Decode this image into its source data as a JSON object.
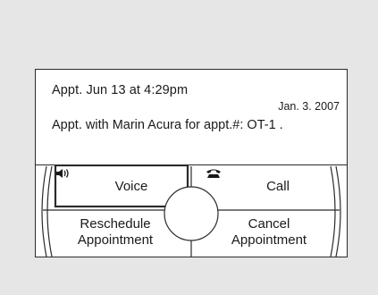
{
  "message": {
    "title": "Appt. Jun  13 at  4:29pm",
    "date": "Jan. 3. 2007",
    "body": "Appt. with Marin Acura for appt.#: OT-1 ."
  },
  "controls": {
    "voice_label": "Voice",
    "voice_icon": "speaker-icon",
    "call_label": "Call",
    "call_icon": "phone-icon",
    "reschedule_line1": "Reschedule",
    "reschedule_line2": "Appointment",
    "cancel_line1": "Cancel",
    "cancel_line2": "Appointment"
  }
}
